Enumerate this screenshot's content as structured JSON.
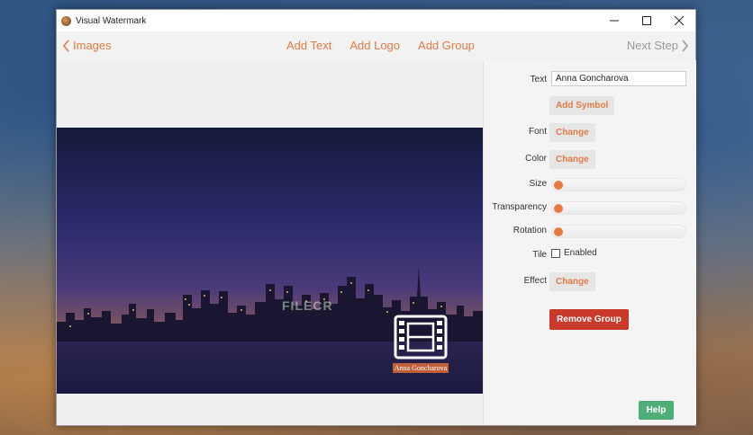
{
  "window": {
    "title": "Visual Watermark"
  },
  "nav": {
    "back_label": "Images",
    "links": [
      "Add Text",
      "Add Logo",
      "Add Group"
    ],
    "next_label": "Next Step"
  },
  "preview": {
    "watermark_text": "Anna Goncharova",
    "site_watermark": "FILECR"
  },
  "panel": {
    "text_label": "Text",
    "text_value": "Anna Goncharova",
    "add_symbol_label": "Add Symbol",
    "font_label": "Font",
    "font_button": "Change",
    "color_label": "Color",
    "color_button": "Change",
    "size_label": "Size",
    "size_value": "",
    "transparency_label": "Transparency",
    "transparency_value": "0%",
    "rotation_label": "Rotation",
    "rotation_value": "0°",
    "tile_label": "Tile",
    "tile_checkbox_label": "Enabled",
    "tile_enabled": false,
    "effect_label": "Effect",
    "effect_button": "Change",
    "remove_group_label": "Remove Group",
    "help_label": "Help"
  },
  "colors": {
    "accent": "#e07b46",
    "remove": "#c93a2a",
    "help": "#4fae78"
  }
}
